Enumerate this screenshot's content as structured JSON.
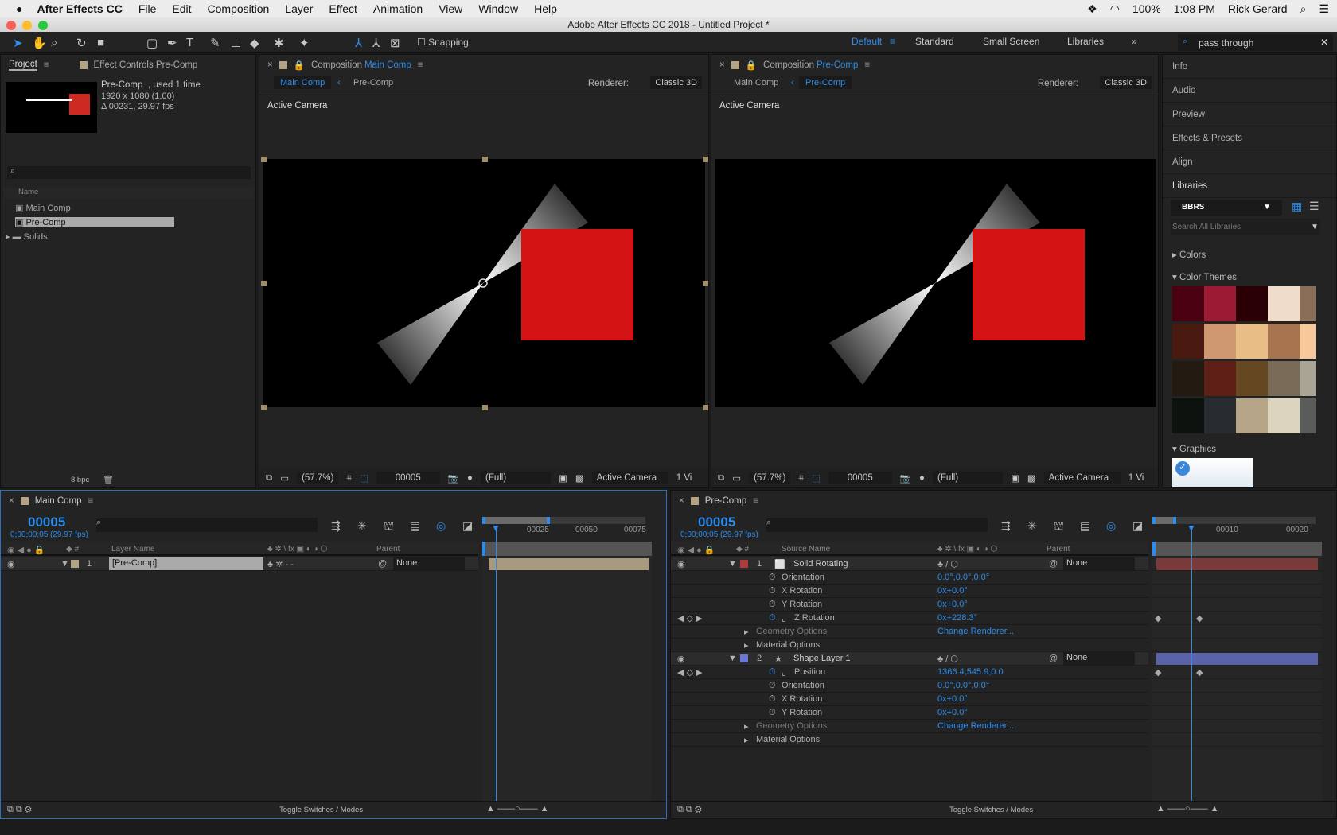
{
  "menubar": {
    "app": "After Effects CC",
    "items": [
      "File",
      "Edit",
      "Composition",
      "Layer",
      "Effect",
      "Animation",
      "View",
      "Window",
      "Help"
    ],
    "battery": "100%",
    "time": "1:08 PM",
    "user": "Rick Gerard"
  },
  "window": {
    "title": "Adobe After Effects CC 2018 - Untitled Project *"
  },
  "toolbar": {
    "snapping": "Snapping",
    "workspaces": [
      "Default",
      "Standard",
      "Small Screen",
      "Libraries"
    ],
    "search_value": "pass through"
  },
  "project": {
    "tab": "Project",
    "tab2": "Effect Controls Pre-Comp",
    "item_name": "Pre-Comp",
    "item_used": ", used 1 time",
    "item_size": "1920 x 1080 (1.00)",
    "item_duration": "Δ 00231, 29.97 fps",
    "col_name": "Name",
    "items": [
      "Main Comp",
      "Pre-Comp",
      "Solids"
    ],
    "bpc": "8 bpc"
  },
  "comp1": {
    "tab_prefix": "Composition",
    "tab_name": "Main Comp",
    "crumbs": [
      "Main Comp",
      "Pre-Comp"
    ],
    "renderer_label": "Renderer:",
    "renderer": "Classic 3D",
    "view": "Active Camera",
    "zoom": "(57.7%)",
    "time": "00005",
    "res": "(Full)",
    "camera": "Active Camera",
    "views": "1 Vi"
  },
  "comp2": {
    "tab_prefix": "Composition",
    "tab_name": "Pre-Comp",
    "crumbs": [
      "Main Comp",
      "Pre-Comp"
    ],
    "renderer_label": "Renderer:",
    "renderer": "Classic 3D",
    "view": "Active Camera",
    "zoom": "(57.7%)",
    "time": "00005",
    "res": "(Full)",
    "camera": "Active Camera",
    "views": "1 Vi"
  },
  "right": {
    "items": [
      "Info",
      "Audio",
      "Preview",
      "Effects & Presets",
      "Align",
      "Libraries"
    ],
    "library": "BBRS",
    "search_placeholder": "Search All Libraries",
    "colors": "Colors",
    "color_themes": "Color Themes",
    "graphics": "Graphics",
    "themes": [
      [
        "#4a0010",
        "#9c1a34",
        "#2a0006",
        "#f0dccb",
        "#8a6e58"
      ],
      [
        "#4a1a10",
        "#d09870",
        "#e8be86",
        "#a87450",
        "#f6c89a"
      ],
      [
        "#231a12",
        "#5e2016",
        "#654822",
        "#7a6a58",
        "#aaa496"
      ],
      [
        "#0e120e",
        "#262c30",
        "#b7a588",
        "#dcd4bc",
        "#5a5c5a"
      ]
    ]
  },
  "tl1": {
    "tab": "Main Comp",
    "time": "00005",
    "time_sub": "0;00;00;05 (29.97 fps)",
    "col_layer": "Layer Name",
    "col_parent": "Parent",
    "ruler": [
      "00025",
      "00050",
      "00075"
    ],
    "layer_num": "1",
    "layer_name": "[Pre-Comp]",
    "parent": "None",
    "toggle": "Toggle Switches / Modes"
  },
  "tl2": {
    "tab": "Pre-Comp",
    "time": "00005",
    "time_sub": "0;00;00;05 (29.97 fps)",
    "col_source": "Source Name",
    "col_parent": "Parent",
    "ruler": [
      "00010",
      "00020"
    ],
    "toggle": "Toggle Switches / Modes",
    "rows": [
      {
        "type": "layer",
        "num": "1",
        "name": "Solid Rotating",
        "parent": "None",
        "color": "#b03a3a"
      },
      {
        "type": "prop",
        "name": "Orientation",
        "value": "0.0°,0.0°,0.0°"
      },
      {
        "type": "prop",
        "name": "X Rotation",
        "value": "0x+0.0°"
      },
      {
        "type": "prop",
        "name": "Y Rotation",
        "value": "0x+0.0°"
      },
      {
        "type": "keyed",
        "name": "Z Rotation",
        "value": "0x+228.3°"
      },
      {
        "type": "group",
        "name": "Geometry Options",
        "value": "Change Renderer...",
        "dim": true
      },
      {
        "type": "group",
        "name": "Material Options",
        "value": ""
      },
      {
        "type": "layer",
        "num": "2",
        "name": "Shape Layer 1",
        "parent": "None",
        "color": "#6a78d8"
      },
      {
        "type": "keyed",
        "name": "Position",
        "value": "1366.4,545.9,0.0"
      },
      {
        "type": "prop",
        "name": "Orientation",
        "value": "0.0°,0.0°,0.0°"
      },
      {
        "type": "prop",
        "name": "X Rotation",
        "value": "0x+0.0°"
      },
      {
        "type": "prop",
        "name": "Y Rotation",
        "value": "0x+0.0°"
      },
      {
        "type": "group",
        "name": "Geometry Options",
        "value": "Change Renderer...",
        "dim": true
      },
      {
        "type": "group",
        "name": "Material Options",
        "value": ""
      }
    ]
  },
  "colors": {
    "accent": "#2d8ceb",
    "solid": "#d41414"
  }
}
